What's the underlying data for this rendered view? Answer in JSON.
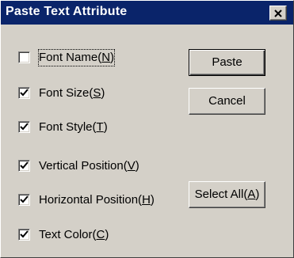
{
  "window": {
    "title": "Paste Text Attribute"
  },
  "checkboxes": [
    {
      "label": "Font Name(",
      "mnemonic": "N",
      "suffix": ")",
      "checked": false
    },
    {
      "label": "Font Size(",
      "mnemonic": "S",
      "suffix": ")",
      "checked": true
    },
    {
      "label": "Font Style(",
      "mnemonic": "T",
      "suffix": ")",
      "checked": true
    },
    {
      "label": "Vertical Position(",
      "mnemonic": "V",
      "suffix": ")",
      "checked": true
    },
    {
      "label": "Horizontal Position(",
      "mnemonic": "H",
      "suffix": ")",
      "checked": true
    },
    {
      "label": "Text Color(",
      "mnemonic": "C",
      "suffix": ")",
      "checked": true
    }
  ],
  "buttons": {
    "paste": "Paste",
    "cancel": "Cancel",
    "select_all_label": "Select All(",
    "select_all_mnemonic": "A",
    "select_all_suffix": ")"
  },
  "icons": {
    "close": "close-icon",
    "check": "checkmark-icon"
  },
  "colors": {
    "titlebar": "#0a246a",
    "face": "#d4d0c8"
  }
}
